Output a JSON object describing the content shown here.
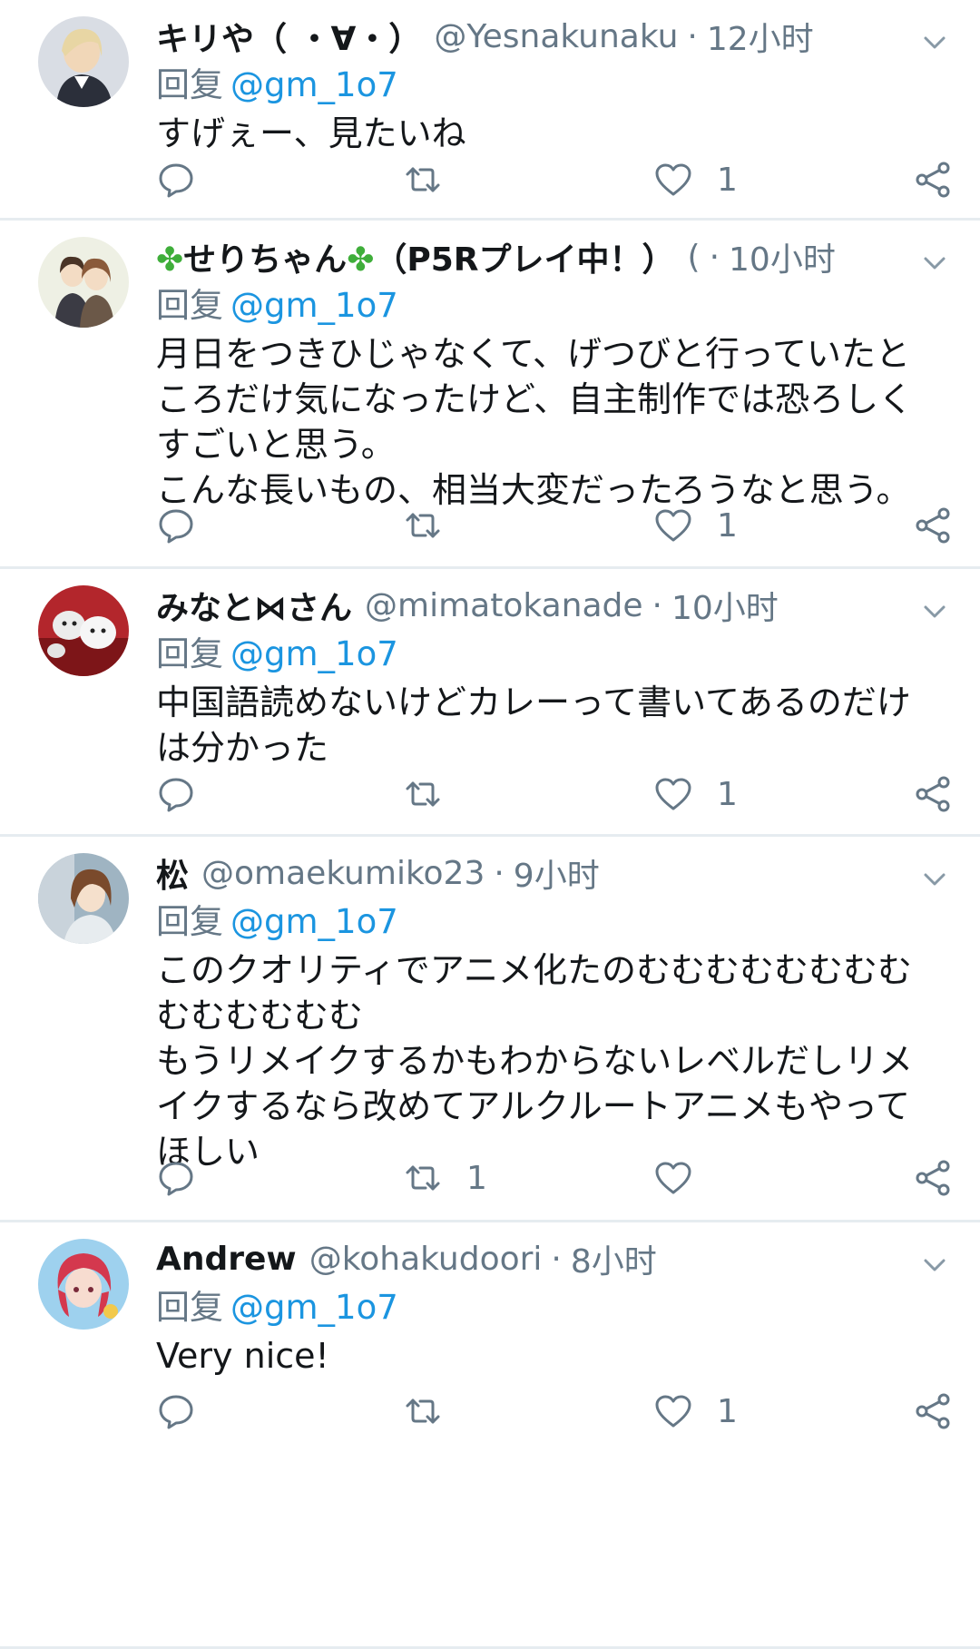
{
  "reply_prefix": "回复",
  "tweets": [
    {
      "name": "キリや（ ・∀・）",
      "handle": "@Yesnakunaku",
      "dot": "·",
      "time": "12小时",
      "reply_to": "@gm_1o7",
      "text": "すげぇー、見たいね",
      "replies": "",
      "retweets": "",
      "likes": "1"
    },
    {
      "name": "✤せりちゃん✤（P5Rプレイ中！）",
      "handle": "(",
      "dot": "·",
      "time": "10小时",
      "reply_to": "@gm_1o7",
      "text": "月日をつきひじゃなくて、げつびと行っていたと\nころだけ気になったけど、自主制作では恐ろしく\nすごいと思う。\nこんな長いもの、相当大変だったろうなと思う。",
      "replies": "",
      "retweets": "",
      "likes": "1"
    },
    {
      "name": "みなと⋈さん",
      "handle": "@mimatokanade",
      "dot": "·",
      "time": "10小时",
      "reply_to": "@gm_1o7",
      "text": "中国語読めないけどカレーって書いてあるのだけ\nは分かった",
      "replies": "",
      "retweets": "",
      "likes": "1"
    },
    {
      "name": "松",
      "handle": "@omaekumiko23",
      "dot": "·",
      "time": "9小时",
      "reply_to": "@gm_1o7",
      "text": "このクオリティでアニメ化たのむむむむむむむむ\nむむむむむむ\nもうリメイクするかもわからないレベルだしリメ\nイクするなら改めてアルクルートアニメもやって\nほしい",
      "replies": "",
      "retweets": "1",
      "likes": ""
    },
    {
      "name": "Andrew",
      "handle": "@kohakudoori",
      "dot": "·",
      "time": "8小时",
      "reply_to": "@gm_1o7",
      "text": "Very nice!",
      "replies": "",
      "retweets": "",
      "likes": "1"
    }
  ],
  "colors": {
    "link": "#1b95e0",
    "secondary": "#657786",
    "divider": "#e6ecf0",
    "clover": "#3fae3a"
  },
  "icons": [
    "chevron-down-icon",
    "reply-icon",
    "retweet-icon",
    "like-icon",
    "share-icon"
  ]
}
